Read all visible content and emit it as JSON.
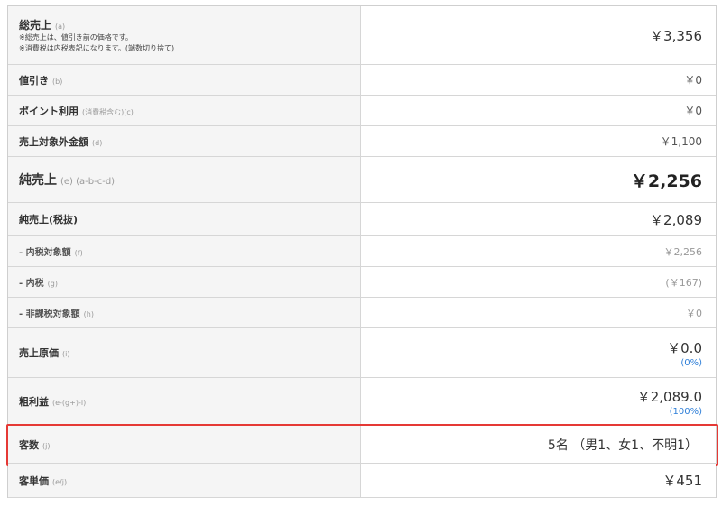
{
  "rows": [
    {
      "label": "総売上",
      "code": "(a)",
      "notes": [
        "※総売上は、値引き前の価格です。",
        "※消費税は内税表記になります。(端数切り捨て)"
      ],
      "value": "￥3,356"
    },
    {
      "label": "値引き",
      "code": "(b)",
      "value": "￥0"
    },
    {
      "label": "ポイント利用",
      "code": "(消費税含む)(c)",
      "value": "￥0"
    },
    {
      "label": "売上対象外金額",
      "code": "(d)",
      "value": "￥1,100"
    },
    {
      "label": "純売上",
      "code": "(e)   (a-b-c-d)",
      "value": "￥2,256"
    },
    {
      "label": "純売上(税抜)",
      "code": "",
      "value": "￥2,089"
    },
    {
      "label": " - 内税対象額",
      "code": "(f)",
      "value": "￥2,256"
    },
    {
      "label": " - 内税",
      "code": "(g)",
      "value": "(￥167)"
    },
    {
      "label": " - 非課税対象額",
      "code": "(h)",
      "value": "￥0"
    },
    {
      "label": "売上原価",
      "code": "(i)",
      "value": "￥0.0",
      "pct": "(0%)"
    },
    {
      "label": "粗利益",
      "code": "(e-(g+)-i)",
      "value": "￥2,089.0",
      "pct": "(100%)"
    },
    {
      "label": "客数",
      "code": "(j)",
      "value": "5名 （男1、女1、不明1）"
    },
    {
      "label": "客単価",
      "code": "(e/j)",
      "value": "￥451"
    }
  ],
  "colors": {
    "highlight": "#e53935",
    "link": "#2f7fd8"
  }
}
